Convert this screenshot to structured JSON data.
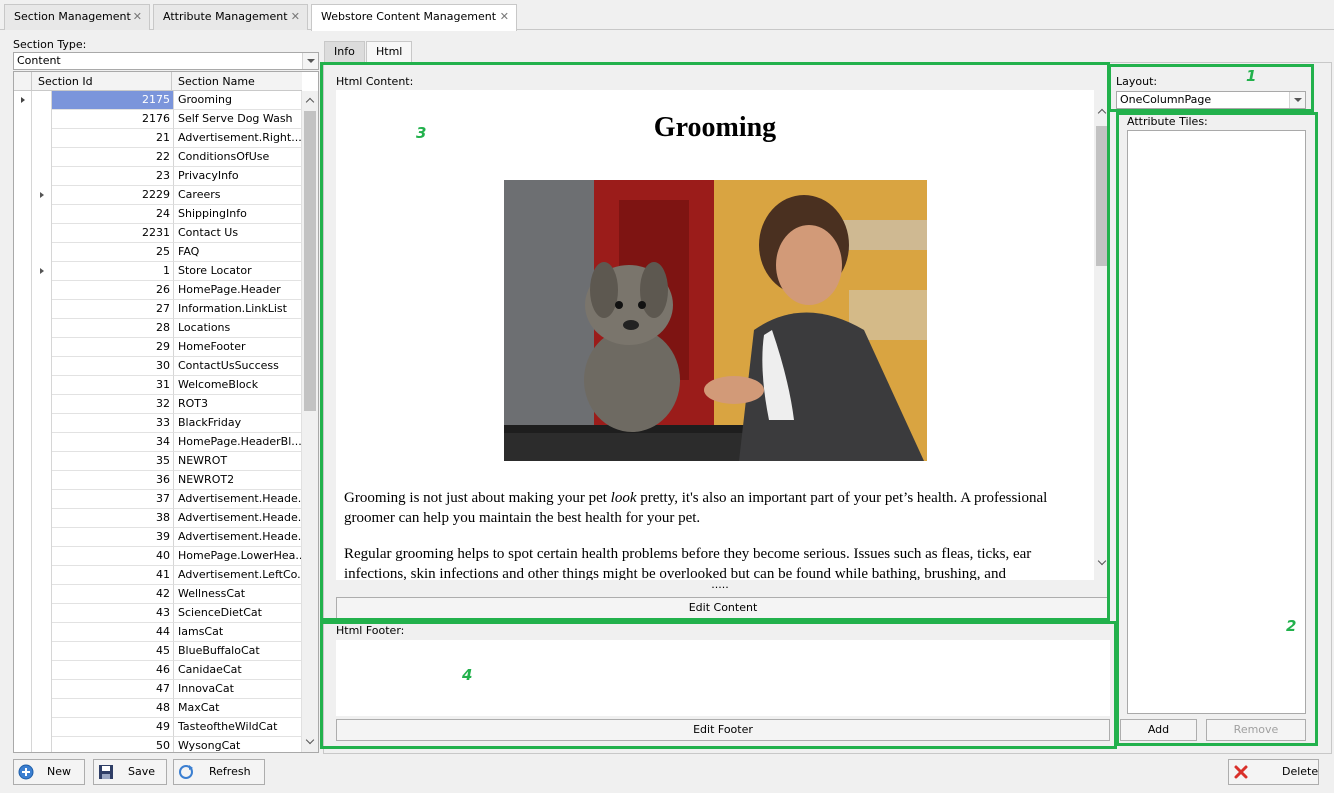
{
  "doc_tabs": [
    {
      "label": "Section Management"
    },
    {
      "label": "Attribute Management"
    },
    {
      "label": "Webstore Content Management"
    }
  ],
  "left": {
    "section_type_label": "Section Type:",
    "section_type_value": "Content",
    "columns": {
      "id": "Section Id",
      "name": "Section Name"
    },
    "rows": [
      {
        "id": "2175",
        "name": "Grooming"
      },
      {
        "id": "2176",
        "name": "Self Serve Dog Wash"
      },
      {
        "id": "21",
        "name": "Advertisement.Right..."
      },
      {
        "id": "22",
        "name": "ConditionsOfUse"
      },
      {
        "id": "23",
        "name": "PrivacyInfo"
      },
      {
        "id": "2229",
        "name": "Careers"
      },
      {
        "id": "24",
        "name": "ShippingInfo"
      },
      {
        "id": "2231",
        "name": "Contact Us"
      },
      {
        "id": "25",
        "name": "FAQ"
      },
      {
        "id": "1",
        "name": "Store Locator"
      },
      {
        "id": "26",
        "name": "HomePage.Header"
      },
      {
        "id": "27",
        "name": "Information.LinkList"
      },
      {
        "id": "28",
        "name": "Locations"
      },
      {
        "id": "29",
        "name": "HomeFooter"
      },
      {
        "id": "30",
        "name": "ContactUsSuccess"
      },
      {
        "id": "31",
        "name": "WelcomeBlock"
      },
      {
        "id": "32",
        "name": "ROT3"
      },
      {
        "id": "33",
        "name": "BlackFriday"
      },
      {
        "id": "34",
        "name": "HomePage.HeaderBl..."
      },
      {
        "id": "35",
        "name": "NEWROT"
      },
      {
        "id": "36",
        "name": "NEWROT2"
      },
      {
        "id": "37",
        "name": "Advertisement.Heade..."
      },
      {
        "id": "38",
        "name": "Advertisement.Heade..."
      },
      {
        "id": "39",
        "name": "Advertisement.Heade..."
      },
      {
        "id": "40",
        "name": "HomePage.LowerHea..."
      },
      {
        "id": "41",
        "name": "Advertisement.LeftCo..."
      },
      {
        "id": "42",
        "name": "WellnessCat"
      },
      {
        "id": "43",
        "name": "ScienceDietCat"
      },
      {
        "id": "44",
        "name": "IamsCat"
      },
      {
        "id": "45",
        "name": "BlueBuffaloCat"
      },
      {
        "id": "46",
        "name": "CanidaeCat"
      },
      {
        "id": "47",
        "name": "InnovaCat"
      },
      {
        "id": "48",
        "name": "MaxCat"
      },
      {
        "id": "49",
        "name": "TasteoftheWildCat"
      },
      {
        "id": "50",
        "name": "WysongCat"
      }
    ]
  },
  "center": {
    "tabs": [
      {
        "label": "Info"
      },
      {
        "label": "Html"
      }
    ],
    "html_content_label": "Html Content:",
    "preview_title": "Grooming",
    "preview_para1_a": "Grooming is not just about making your pet ",
    "preview_para1_em": "look",
    "preview_para1_b": " pretty, it's also an important part of your pet’s health.  A professional groomer can help you maintain the best health for your pet.",
    "preview_para2": "Regular grooming helps to spot certain health problems before they become serious. Issues such as fleas, ticks, ear infections, skin infections and other things might be overlooked but can be found while bathing, brushing, and",
    "splitter_dots": ".....",
    "edit_content_label": "Edit Content",
    "html_footer_label": "Html Footer:",
    "edit_footer_label": "Edit Footer"
  },
  "right": {
    "layout_label": "Layout:",
    "layout_value": "OneColumnPage",
    "attribute_tiles_label": "Attribute Tiles:",
    "add_label": "Add",
    "remove_label": "Remove"
  },
  "annotations": {
    "n1": "1",
    "n2": "2",
    "n3": "3",
    "n4": "4",
    "color": "#22b14c"
  },
  "bottom": {
    "new_label": "New",
    "save_label": "Save",
    "refresh_label": "Refresh",
    "delete_label": "Delete"
  },
  "icons": [
    "plus-circle-icon",
    "floppy-disk-icon",
    "refresh-icon",
    "delete-x-icon",
    "close-icon",
    "chevron-up-icon",
    "chevron-down-icon"
  ]
}
